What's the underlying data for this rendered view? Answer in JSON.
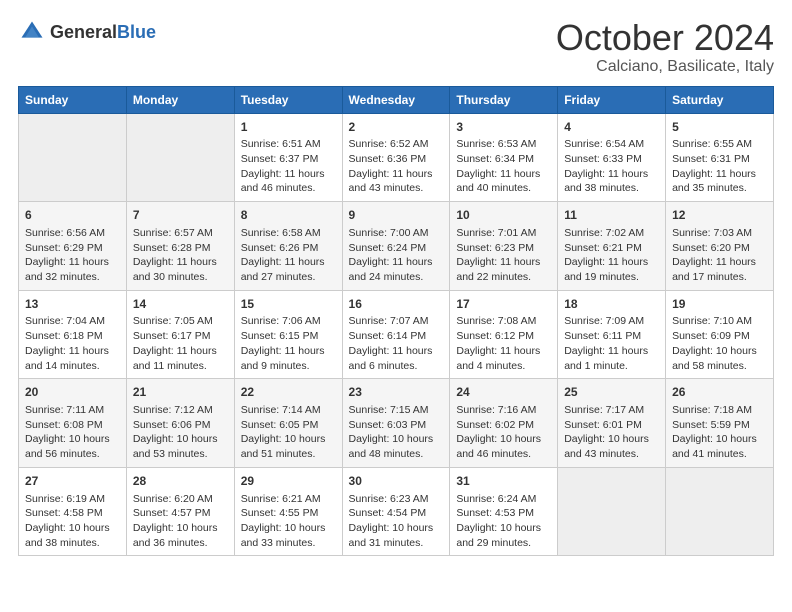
{
  "logo": {
    "general": "General",
    "blue": "Blue"
  },
  "title": "October 2024",
  "subtitle": "Calciano, Basilicate, Italy",
  "days_of_week": [
    "Sunday",
    "Monday",
    "Tuesday",
    "Wednesday",
    "Thursday",
    "Friday",
    "Saturday"
  ],
  "weeks": [
    [
      {
        "day": "",
        "empty": true
      },
      {
        "day": "",
        "empty": true
      },
      {
        "day": "1",
        "sunrise": "Sunrise: 6:51 AM",
        "sunset": "Sunset: 6:37 PM",
        "daylight": "Daylight: 11 hours and 46 minutes."
      },
      {
        "day": "2",
        "sunrise": "Sunrise: 6:52 AM",
        "sunset": "Sunset: 6:36 PM",
        "daylight": "Daylight: 11 hours and 43 minutes."
      },
      {
        "day": "3",
        "sunrise": "Sunrise: 6:53 AM",
        "sunset": "Sunset: 6:34 PM",
        "daylight": "Daylight: 11 hours and 40 minutes."
      },
      {
        "day": "4",
        "sunrise": "Sunrise: 6:54 AM",
        "sunset": "Sunset: 6:33 PM",
        "daylight": "Daylight: 11 hours and 38 minutes."
      },
      {
        "day": "5",
        "sunrise": "Sunrise: 6:55 AM",
        "sunset": "Sunset: 6:31 PM",
        "daylight": "Daylight: 11 hours and 35 minutes."
      }
    ],
    [
      {
        "day": "6",
        "sunrise": "Sunrise: 6:56 AM",
        "sunset": "Sunset: 6:29 PM",
        "daylight": "Daylight: 11 hours and 32 minutes."
      },
      {
        "day": "7",
        "sunrise": "Sunrise: 6:57 AM",
        "sunset": "Sunset: 6:28 PM",
        "daylight": "Daylight: 11 hours and 30 minutes."
      },
      {
        "day": "8",
        "sunrise": "Sunrise: 6:58 AM",
        "sunset": "Sunset: 6:26 PM",
        "daylight": "Daylight: 11 hours and 27 minutes."
      },
      {
        "day": "9",
        "sunrise": "Sunrise: 7:00 AM",
        "sunset": "Sunset: 6:24 PM",
        "daylight": "Daylight: 11 hours and 24 minutes."
      },
      {
        "day": "10",
        "sunrise": "Sunrise: 7:01 AM",
        "sunset": "Sunset: 6:23 PM",
        "daylight": "Daylight: 11 hours and 22 minutes."
      },
      {
        "day": "11",
        "sunrise": "Sunrise: 7:02 AM",
        "sunset": "Sunset: 6:21 PM",
        "daylight": "Daylight: 11 hours and 19 minutes."
      },
      {
        "day": "12",
        "sunrise": "Sunrise: 7:03 AM",
        "sunset": "Sunset: 6:20 PM",
        "daylight": "Daylight: 11 hours and 17 minutes."
      }
    ],
    [
      {
        "day": "13",
        "sunrise": "Sunrise: 7:04 AM",
        "sunset": "Sunset: 6:18 PM",
        "daylight": "Daylight: 11 hours and 14 minutes."
      },
      {
        "day": "14",
        "sunrise": "Sunrise: 7:05 AM",
        "sunset": "Sunset: 6:17 PM",
        "daylight": "Daylight: 11 hours and 11 minutes."
      },
      {
        "day": "15",
        "sunrise": "Sunrise: 7:06 AM",
        "sunset": "Sunset: 6:15 PM",
        "daylight": "Daylight: 11 hours and 9 minutes."
      },
      {
        "day": "16",
        "sunrise": "Sunrise: 7:07 AM",
        "sunset": "Sunset: 6:14 PM",
        "daylight": "Daylight: 11 hours and 6 minutes."
      },
      {
        "day": "17",
        "sunrise": "Sunrise: 7:08 AM",
        "sunset": "Sunset: 6:12 PM",
        "daylight": "Daylight: 11 hours and 4 minutes."
      },
      {
        "day": "18",
        "sunrise": "Sunrise: 7:09 AM",
        "sunset": "Sunset: 6:11 PM",
        "daylight": "Daylight: 11 hours and 1 minute."
      },
      {
        "day": "19",
        "sunrise": "Sunrise: 7:10 AM",
        "sunset": "Sunset: 6:09 PM",
        "daylight": "Daylight: 10 hours and 58 minutes."
      }
    ],
    [
      {
        "day": "20",
        "sunrise": "Sunrise: 7:11 AM",
        "sunset": "Sunset: 6:08 PM",
        "daylight": "Daylight: 10 hours and 56 minutes."
      },
      {
        "day": "21",
        "sunrise": "Sunrise: 7:12 AM",
        "sunset": "Sunset: 6:06 PM",
        "daylight": "Daylight: 10 hours and 53 minutes."
      },
      {
        "day": "22",
        "sunrise": "Sunrise: 7:14 AM",
        "sunset": "Sunset: 6:05 PM",
        "daylight": "Daylight: 10 hours and 51 minutes."
      },
      {
        "day": "23",
        "sunrise": "Sunrise: 7:15 AM",
        "sunset": "Sunset: 6:03 PM",
        "daylight": "Daylight: 10 hours and 48 minutes."
      },
      {
        "day": "24",
        "sunrise": "Sunrise: 7:16 AM",
        "sunset": "Sunset: 6:02 PM",
        "daylight": "Daylight: 10 hours and 46 minutes."
      },
      {
        "day": "25",
        "sunrise": "Sunrise: 7:17 AM",
        "sunset": "Sunset: 6:01 PM",
        "daylight": "Daylight: 10 hours and 43 minutes."
      },
      {
        "day": "26",
        "sunrise": "Sunrise: 7:18 AM",
        "sunset": "Sunset: 5:59 PM",
        "daylight": "Daylight: 10 hours and 41 minutes."
      }
    ],
    [
      {
        "day": "27",
        "sunrise": "Sunrise: 6:19 AM",
        "sunset": "Sunset: 4:58 PM",
        "daylight": "Daylight: 10 hours and 38 minutes."
      },
      {
        "day": "28",
        "sunrise": "Sunrise: 6:20 AM",
        "sunset": "Sunset: 4:57 PM",
        "daylight": "Daylight: 10 hours and 36 minutes."
      },
      {
        "day": "29",
        "sunrise": "Sunrise: 6:21 AM",
        "sunset": "Sunset: 4:55 PM",
        "daylight": "Daylight: 10 hours and 33 minutes."
      },
      {
        "day": "30",
        "sunrise": "Sunrise: 6:23 AM",
        "sunset": "Sunset: 4:54 PM",
        "daylight": "Daylight: 10 hours and 31 minutes."
      },
      {
        "day": "31",
        "sunrise": "Sunrise: 6:24 AM",
        "sunset": "Sunset: 4:53 PM",
        "daylight": "Daylight: 10 hours and 29 minutes."
      },
      {
        "day": "",
        "empty": true
      },
      {
        "day": "",
        "empty": true
      }
    ]
  ]
}
